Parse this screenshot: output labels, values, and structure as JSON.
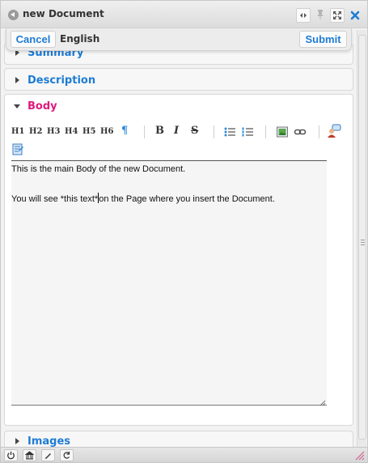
{
  "window": {
    "title": "new Document"
  },
  "titlebar": {
    "buttons": [
      {
        "name": "collapse-icon",
        "glyph": "◂▸"
      },
      {
        "name": "pin-icon",
        "glyph": "✦"
      },
      {
        "name": "maximize-icon",
        "glyph": "⤢"
      },
      {
        "name": "close-icon",
        "glyph": "✖"
      }
    ]
  },
  "actionbar": {
    "cancel_label": "Cancel",
    "language": "English",
    "submit_label": "Submit"
  },
  "sections": {
    "summary": {
      "label": "Summary",
      "expanded": false
    },
    "description": {
      "label": "Description",
      "expanded": false
    },
    "body": {
      "label": "Body",
      "expanded": true
    },
    "images": {
      "label": "Images",
      "expanded": false
    }
  },
  "toolbar": {
    "headings": [
      "H1",
      "H2",
      "H3",
      "H4",
      "H5",
      "H6"
    ],
    "paragraph": "¶",
    "bold": "B",
    "italic": "I",
    "strike": "S",
    "icons": [
      "unordered-list-icon",
      "ordered-list-icon",
      "image-icon",
      "link-icon",
      "user-comment-icon",
      "document-icon"
    ]
  },
  "editor": {
    "line1": "This is the main Body of the new Document.",
    "line2_before_caret": "You will see *this text*",
    "line2_after_caret": "on the Page where you insert the Document."
  },
  "statusbar": {
    "buttons": [
      "power-icon",
      "building-icon",
      "edit-icon",
      "refresh-icon"
    ]
  },
  "colors": {
    "accent": "#1f7cd4",
    "active_section": "#e0197d"
  }
}
